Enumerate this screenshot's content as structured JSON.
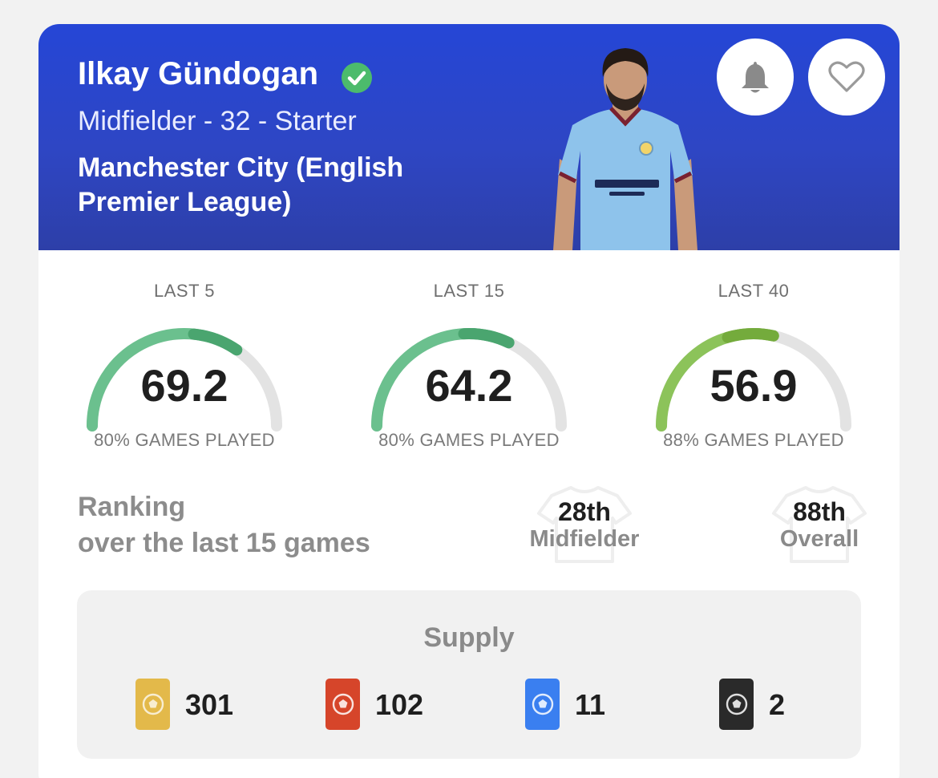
{
  "player": {
    "name": "Ilkay Gündogan",
    "meta": "Midfielder - 32 - Starter",
    "club": "Manchester City (English Premier League)"
  },
  "colors": {
    "header_blue": "#2a44cc",
    "verified_green": "#4cbb6c",
    "gauge_green": "#6bc08e",
    "gauge_green_dark": "#4aa56f",
    "gauge_lime": "#8cc35a",
    "gauge_track": "#e3e3e3",
    "card_gold": "#e3b94a",
    "card_red": "#d6452a",
    "card_blue": "#3a7ff0",
    "card_black": "#2a2a2a"
  },
  "actions": {
    "bell_icon": "bell-icon",
    "heart_icon": "heart-icon"
  },
  "scores": [
    {
      "title": "LAST 5",
      "value": "69.2",
      "played": "80% GAMES PLAYED",
      "fraction": 0.692
    },
    {
      "title": "LAST 15",
      "value": "64.2",
      "played": "80% GAMES PLAYED",
      "fraction": 0.642
    },
    {
      "title": "LAST 40",
      "value": "56.9",
      "played": "88% GAMES PLAYED",
      "fraction": 0.569
    }
  ],
  "ranking": {
    "label_line1": "Ranking",
    "label_line2": "over the last 15 games",
    "position": {
      "value": "28th",
      "caption": "Midfielder"
    },
    "overall": {
      "value": "88th",
      "caption": "Overall"
    }
  },
  "supply": {
    "title": "Supply",
    "items": [
      {
        "rarity_icon": "gold-card-icon",
        "count": "301"
      },
      {
        "rarity_icon": "red-card-icon",
        "count": "102"
      },
      {
        "rarity_icon": "blue-card-icon",
        "count": "11"
      },
      {
        "rarity_icon": "black-card-icon",
        "count": "2"
      }
    ]
  }
}
